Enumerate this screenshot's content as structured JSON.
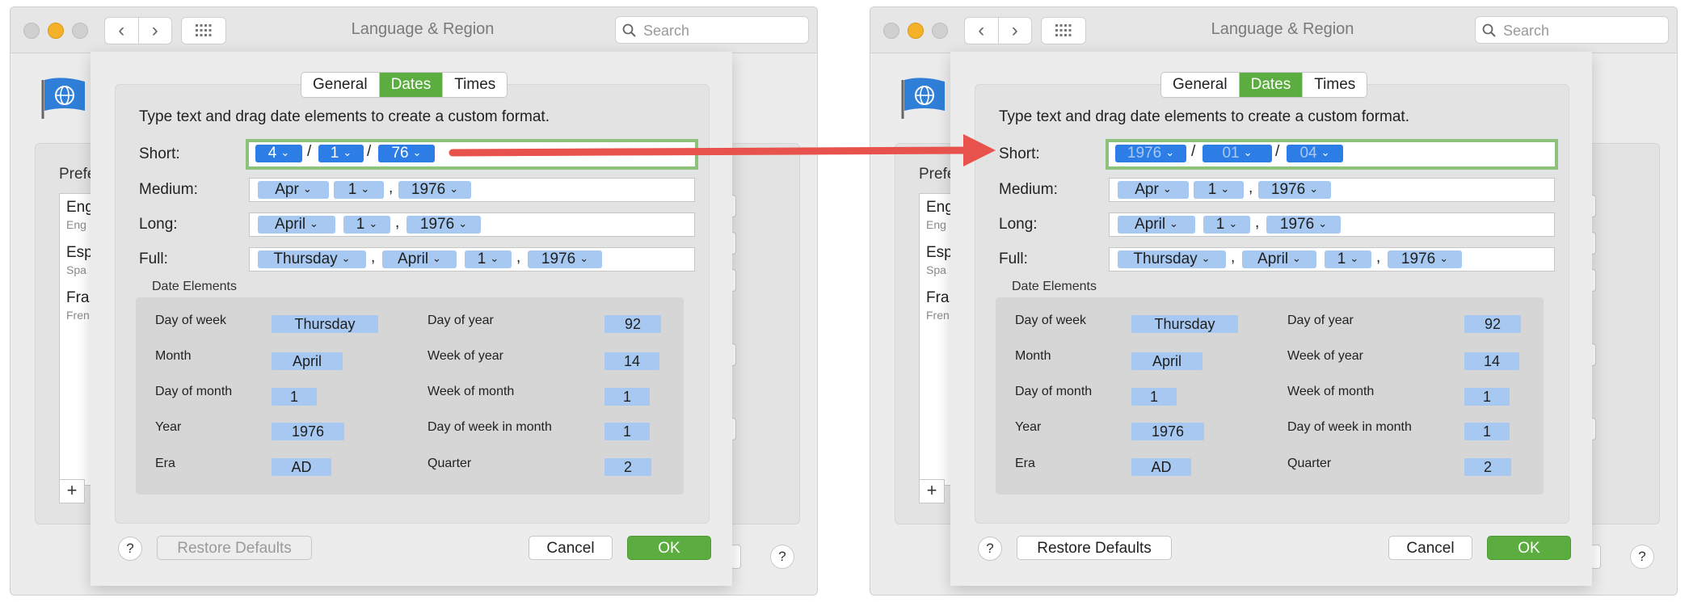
{
  "panels": [
    {
      "window_title": "Language & Region",
      "search_placeholder": "Search",
      "preferred_label": "Prefe",
      "languages": [
        {
          "name": "Eng",
          "sub": "Eng"
        },
        {
          "name": "Esp",
          "sub": "Spa"
        },
        {
          "name": "Fra",
          "sub": "Fren"
        }
      ],
      "add_label": "+",
      "help_label": "?",
      "tabs": [
        "General",
        "Dates",
        "Times"
      ],
      "active_tab": "Dates",
      "instructions": "Type text and drag date elements to create a custom format.",
      "formats": {
        "short": {
          "label": "Short:",
          "tokens": [
            "4",
            "1",
            "76"
          ],
          "separators": [
            "/",
            "/"
          ]
        },
        "medium": {
          "label": "Medium:",
          "tokens": [
            "Apr",
            "1",
            "1976"
          ],
          "separators": [
            ","
          ]
        },
        "long": {
          "label": "Long:",
          "tokens": [
            "April",
            "1",
            "1976"
          ],
          "separators": [
            ","
          ]
        },
        "full": {
          "label": "Full:",
          "tokens": [
            "Thursday",
            "April",
            "1",
            "1976"
          ],
          "separators": [
            ",",
            ","
          ]
        }
      },
      "date_elements_title": "Date Elements",
      "date_elements": {
        "left": [
          {
            "label": "Day of week",
            "value": "Thursday"
          },
          {
            "label": "Month",
            "value": "April"
          },
          {
            "label": "Day of month",
            "value": "1"
          },
          {
            "label": "Year",
            "value": "1976"
          },
          {
            "label": "Era",
            "value": "AD"
          }
        ],
        "right": [
          {
            "label": "Day of year",
            "value": "92"
          },
          {
            "label": "Week of year",
            "value": "14"
          },
          {
            "label": "Week of month",
            "value": "1"
          },
          {
            "label": "Day of week in month",
            "value": "1"
          },
          {
            "label": "Quarter",
            "value": "2"
          }
        ]
      },
      "restore_label": "Restore Defaults",
      "restore_enabled": false,
      "cancel_label": "Cancel",
      "ok_label": "OK"
    },
    {
      "window_title": "Language & Region",
      "search_placeholder": "Search",
      "preferred_label": "Prefe",
      "languages": [
        {
          "name": "Eng",
          "sub": "Eng"
        },
        {
          "name": "Esp",
          "sub": "Spa"
        },
        {
          "name": "Fra",
          "sub": "Fren"
        }
      ],
      "add_label": "+",
      "help_label": "?",
      "tabs": [
        "General",
        "Dates",
        "Times"
      ],
      "active_tab": "Dates",
      "instructions": "Type text and drag date elements to create a custom format.",
      "formats": {
        "short": {
          "label": "Short:",
          "tokens": [
            "1976",
            "01",
            "04"
          ],
          "separators": [
            "/",
            "/"
          ]
        },
        "medium": {
          "label": "Medium:",
          "tokens": [
            "Apr",
            "1",
            "1976"
          ],
          "separators": [
            ","
          ]
        },
        "long": {
          "label": "Long:",
          "tokens": [
            "April",
            "1",
            "1976"
          ],
          "separators": [
            ","
          ]
        },
        "full": {
          "label": "Full:",
          "tokens": [
            "Thursday",
            "April",
            "1",
            "1976"
          ],
          "separators": [
            ",",
            ","
          ]
        }
      },
      "date_elements_title": "Date Elements",
      "date_elements": {
        "left": [
          {
            "label": "Day of week",
            "value": "Thursday"
          },
          {
            "label": "Month",
            "value": "April"
          },
          {
            "label": "Day of month",
            "value": "1"
          },
          {
            "label": "Year",
            "value": "1976"
          },
          {
            "label": "Era",
            "value": "AD"
          }
        ],
        "right": [
          {
            "label": "Day of year",
            "value": "92"
          },
          {
            "label": "Week of year",
            "value": "14"
          },
          {
            "label": "Week of month",
            "value": "1"
          },
          {
            "label": "Day of week in month",
            "value": "1"
          },
          {
            "label": "Quarter",
            "value": "2"
          }
        ]
      },
      "restore_label": "Restore Defaults",
      "restore_enabled": true,
      "cancel_label": "Cancel",
      "ok_label": "OK"
    }
  ],
  "colors": {
    "accent_green": "#5cad40",
    "token_selected": "#2c7ee6",
    "token_light": "#a7c8f0",
    "focus_ring": "#8dc27c",
    "arrow": "#e8524c"
  }
}
